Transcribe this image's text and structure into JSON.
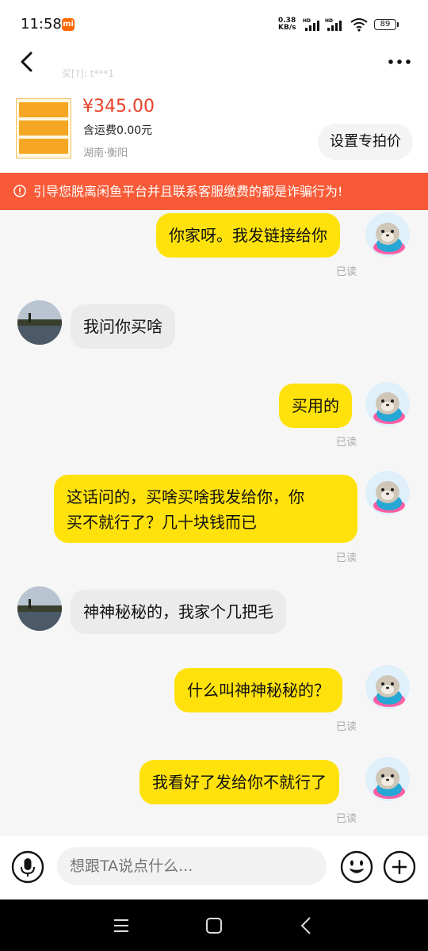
{
  "status_bar": {
    "time": "11:58",
    "carrier_badge": "mi",
    "net_speed_value": "0.38",
    "net_speed_unit": "KB/s",
    "battery": "89"
  },
  "header": {
    "contact_name": "",
    "subtitle": "买[?]: t***1"
  },
  "product": {
    "price": "¥345.00",
    "shipping": "含运费0.00元",
    "location": "湖南·衡阳",
    "set_price_button": "设置专拍价"
  },
  "warning": {
    "text": "引导您脱离闲鱼平台并且联系客服缴费的都是诈骗行为!"
  },
  "messages": [
    {
      "from": "me",
      "text": "你家呀。我发链接给你",
      "status": "已读"
    },
    {
      "from": "other",
      "text": "我问你买啥"
    },
    {
      "from": "me",
      "text": "买用的",
      "status": "已读"
    },
    {
      "from": "me",
      "text_line1": "这话问的，买啥买啥我发给你，你",
      "text_line2": "买不就行了？几十块钱而已",
      "status": "已读"
    },
    {
      "from": "other",
      "text": "神神秘秘的，我家个几把毛"
    },
    {
      "from": "me",
      "text": "什么叫神神秘秘的？",
      "status": "已读"
    },
    {
      "from": "me",
      "text": "我看好了发给你不就行了",
      "status": "已读"
    }
  ],
  "input": {
    "placeholder": "想跟TA说点什么..."
  },
  "colors": {
    "accent_yellow": "#ffe20c",
    "warning_orange": "#f85a37",
    "price_red": "#e8412b"
  },
  "icons": {
    "back": "back-arrow-icon",
    "more": "more-dots-icon",
    "warning": "info-circle-icon",
    "mic": "microphone-icon",
    "emoji": "emoji-icon",
    "plus": "plus-icon",
    "nav_menu": "menu-icon",
    "nav_home": "home-square-icon",
    "nav_back": "back-chevron-icon"
  }
}
